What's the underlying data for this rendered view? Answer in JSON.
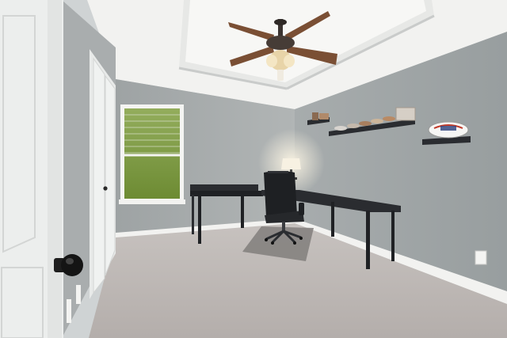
{
  "scene": {
    "type": "photo",
    "subject": "home-office-room",
    "colors": {
      "wall": "#a3a8a9",
      "wall_right": "#9da3a4",
      "ceiling": "#f4f4f2",
      "carpet": "#bdb7b4",
      "baseboard": "#f2f2f0",
      "desk": "#2a2c30",
      "door": "#eceeed",
      "window_foliage": "#7c9a3e"
    },
    "icons": [
      "ceiling-fan-icon",
      "office-chair-icon",
      "table-lamp-icon",
      "football-icon"
    ]
  }
}
